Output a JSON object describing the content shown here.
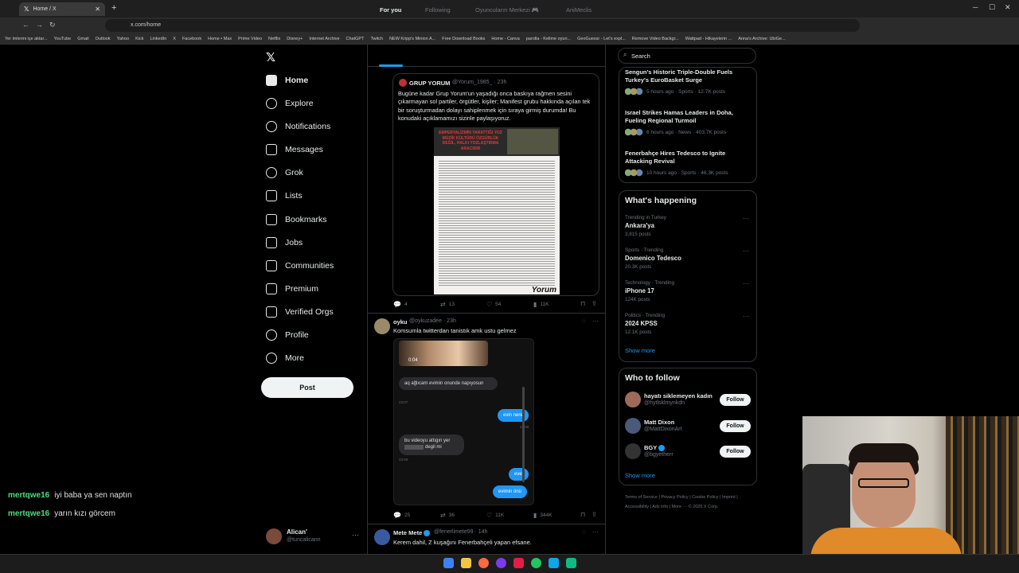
{
  "browser": {
    "tab_title": "Home / X",
    "url": "x.com/home",
    "bookmarks": [
      "Yer imlerini içe aktar...",
      "YouTube",
      "Gmail",
      "Outlook",
      "Yahoo",
      "Kick",
      "LinkedIn",
      "X",
      "Facebook",
      "Home • Max",
      "Prime Video",
      "Netflix",
      "Disney+",
      "Internet Archive",
      "ChatGPT",
      "Twitch",
      "NEW Kripp's Minion A...",
      "Free Download Books",
      "Home - Canva",
      "parolla - Kelime oyun...",
      "GeoGuessr - Let's expl...",
      "Remove Video Backgr...",
      "Wattpad - Hikayelerin ...",
      "Anna's Archive: UbiGe..."
    ]
  },
  "sidebar": {
    "items": [
      {
        "label": "Home",
        "icon": "home-icon"
      },
      {
        "label": "Explore",
        "icon": "search-icon"
      },
      {
        "label": "Notifications",
        "icon": "bell-icon"
      },
      {
        "label": "Messages",
        "icon": "mail-icon"
      },
      {
        "label": "Grok",
        "icon": "grok-icon"
      },
      {
        "label": "Lists",
        "icon": "list-icon"
      },
      {
        "label": "Bookmarks",
        "icon": "bookmark-icon"
      },
      {
        "label": "Jobs",
        "icon": "briefcase-icon"
      },
      {
        "label": "Communities",
        "icon": "people-icon"
      },
      {
        "label": "Premium",
        "icon": "x-icon"
      },
      {
        "label": "Verified Orgs",
        "icon": "lightning-icon"
      },
      {
        "label": "Profile",
        "icon": "person-icon"
      },
      {
        "label": "More",
        "icon": "more-icon"
      }
    ],
    "post_label": "Post",
    "account": {
      "name": "Alican'",
      "handle": "@tuncalicann"
    }
  },
  "feed": {
    "tabs": [
      "For you",
      "Following",
      "Oyuncuların Merkezi 🎮",
      "AniMeclis"
    ],
    "quote": {
      "name": "GRUP YORUM",
      "handle": "@Yorum_1985_ · 23h",
      "text": "Bugüne kadar Grup Yorum'un yaşadığı onca baskıya rağmen sesini çıkarmayan sol partiler, örgütler, kişiler; Manifest grubu hakkında açılan tek bir soruşturmadan dolayı sahiplenmek için sıraya girmiş durumda! Bu konudaki açıklamamızı sizinle paylaşıyoruz.",
      "poster_headline": "EMPERYALİZMİN YARATTIĞI YOZ MÜZİK KÜLTÜRÜ ÖZGÜRLÜK DEĞİL, HALKI YOZLAŞTIRMA ARACIDIR",
      "poster_brand": "Yorum"
    },
    "post1_actions": {
      "replies": "4",
      "reposts": "13",
      "likes": "54",
      "views": "11K"
    },
    "post2": {
      "name": "oyku",
      "handle": "@oykuzadee · 23h",
      "text": "Komsumla twitterdan tanistık amk ustu gelmez",
      "chat": {
        "video_duration": "0:04",
        "msg1": "aq ağlıcam evimin onunde napıyosun",
        "time1": "23:07",
        "msg2": "evin nere",
        "time2": "23:08",
        "msg3": "bu videoyu attıgın yer",
        "msg3b": "degil mi",
        "time3": "23:09",
        "msg4": "evet",
        "msg5": "evimin önü"
      },
      "actions": {
        "replies": "25",
        "reposts": "36",
        "likes": "11K",
        "views": "344K"
      }
    },
    "post3": {
      "name": "Mete Mete",
      "handle": "@fenerlimete99 · 14h",
      "text": "Kerem dahil, Z kuşağını Fenerbahçeli yapan efsane."
    }
  },
  "right": {
    "search_placeholder": "Search",
    "news": [
      {
        "title": "Sengun's Historic Triple-Double Fuels Turkey's EuroBasket Surge",
        "meta": "5 hours ago · Sports · 12.7K posts"
      },
      {
        "title": "Israel Strikes Hamas Leaders in Doha, Fueling Regional Turmoil",
        "meta": "6 hours ago · News · 403.7K posts"
      },
      {
        "title": "Fenerbahçe Hires Tedesco to Ignite Attacking Revival",
        "meta": "10 hours ago · Sports · 46.3K posts"
      }
    ],
    "happening_title": "What's happening",
    "trends": [
      {
        "cat": "Trending in Turkey",
        "name": "Ankara'ya",
        "count": "3,815 posts"
      },
      {
        "cat": "Sports · Trending",
        "name": "Domenico Tedesco",
        "count": "20.3K posts"
      },
      {
        "cat": "Technology · Trending",
        "name": "iPhone 17",
        "count": "124K posts"
      },
      {
        "cat": "Politics · Trending",
        "name": "2024 KPSS",
        "count": "12.1K posts"
      }
    ],
    "show_more": "Show more",
    "wtf_title": "Who to follow",
    "follow_label": "Follow",
    "who": [
      {
        "name": "hayatı siklemeyen kadın",
        "handle": "@hytlsklmynkdn"
      },
      {
        "name": "Matt Dixon",
        "handle": "@MattDixonArt"
      },
      {
        "name": "BGY",
        "handle": "@bgyetherr"
      }
    ],
    "footer": "Terms of Service | Privacy Policy | Cookie Policy | Imprint | Accessibility | Ads info | More ··· © 2025 X Corp."
  },
  "stream_chat": [
    {
      "user": "mertqwe16",
      "msg": "iyi baba ya sen naptın"
    },
    {
      "user": "mertqwe16",
      "msg": "yarın kızı görcem"
    }
  ],
  "colors": {
    "accent": "#1d9bf0",
    "username": "#4ade80",
    "bg": "#000000"
  }
}
